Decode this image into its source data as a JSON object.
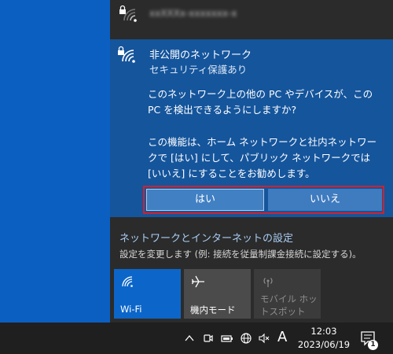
{
  "networks": {
    "top": {
      "name_blurred": "xxXXXx-xxxxxxx-x"
    },
    "selected": {
      "title": "非公開のネットワーク",
      "security": "セキュリティ保護あり",
      "question": "このネットワーク上の他の PC やデバイスが、この PC を検出できるようにしますか?",
      "info": "この機能は、ホーム ネットワークと社内ネットワークで [はい] にして、パブリック ネットワークでは [いいえ] にすることをお勧めします。",
      "yes_label": "はい",
      "no_label": "いいえ"
    }
  },
  "settings": {
    "link": "ネットワークとインターネットの設定",
    "description": "設定を変更します (例: 接続を従量制課金接続に設定する)。"
  },
  "quick_actions": [
    {
      "label": "Wi-Fi",
      "state": "on",
      "icon": "wifi-icon"
    },
    {
      "label": "機内モード",
      "state": "off",
      "icon": "airplane-icon"
    },
    {
      "label": "モバイル ホットスポット",
      "state": "disabled",
      "icon": "hotspot-icon"
    }
  ],
  "taskbar": {
    "ime_label": "A",
    "time": "12:03",
    "date": "2023/06/19",
    "notification_count": "1"
  },
  "colors": {
    "accent": "#0c66c9",
    "selected_bg": "#15559c",
    "highlight": "#d3202c"
  }
}
